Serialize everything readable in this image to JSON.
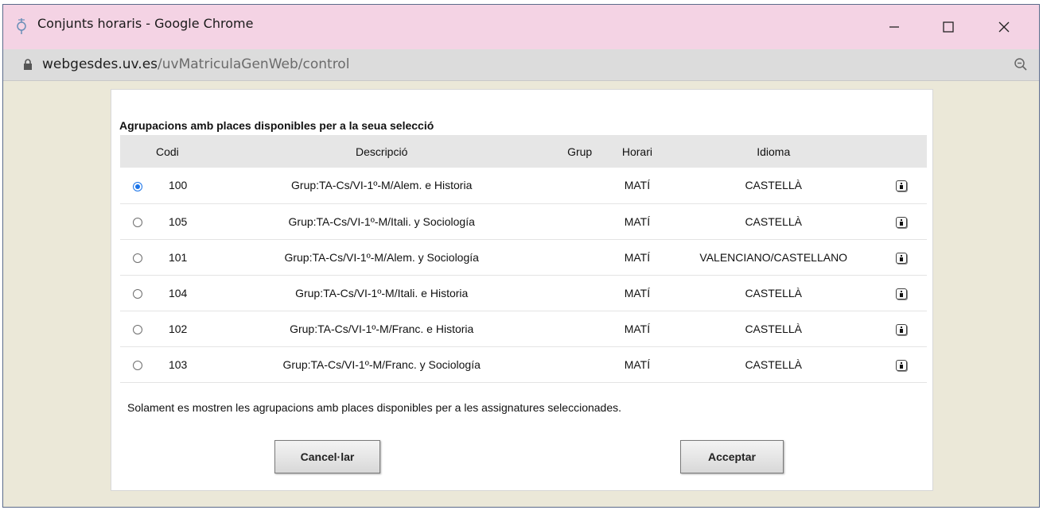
{
  "window": {
    "title": "Conjunts horaris - Google Chrome",
    "url_host": "webgesdes.uv.es",
    "url_path": "/uvMatriculaGenWeb/control"
  },
  "panel": {
    "heading": "Agrupacions amb places disponibles per a la seua selecció",
    "columns": {
      "codi": "Codi",
      "descripcio": "Descripció",
      "grup": "Grup",
      "horari": "Horari",
      "idioma": "Idioma"
    },
    "rows": [
      {
        "codi": "100",
        "descripcio": "Grup:TA-Cs/VI-1º-M/Alem. e Historia",
        "grup": "",
        "horari": "MATÍ",
        "idioma": "CASTELLÀ",
        "selected": true
      },
      {
        "codi": "105",
        "descripcio": "Grup:TA-Cs/VI-1º-M/Itali. y Sociología",
        "grup": "",
        "horari": "MATÍ",
        "idioma": "CASTELLÀ",
        "selected": false
      },
      {
        "codi": "101",
        "descripcio": "Grup:TA-Cs/VI-1º-M/Alem. y Sociología",
        "grup": "",
        "horari": "MATÍ",
        "idioma": "VALENCIANO/CASTELLANO",
        "selected": false
      },
      {
        "codi": "104",
        "descripcio": "Grup:TA-Cs/VI-1º-M/Itali. e Historia",
        "grup": "",
        "horari": "MATÍ",
        "idioma": "CASTELLÀ",
        "selected": false
      },
      {
        "codi": "102",
        "descripcio": "Grup:TA-Cs/VI-1º-M/Franc. e Historia",
        "grup": "",
        "horari": "MATÍ",
        "idioma": "CASTELLÀ",
        "selected": false
      },
      {
        "codi": "103",
        "descripcio": "Grup:TA-Cs/VI-1º-M/Franc. y Sociología",
        "grup": "",
        "horari": "MATÍ",
        "idioma": "CASTELLÀ",
        "selected": false
      }
    ],
    "footnote": "Solament es mostren les agrupacions amb places disponibles per a les assignatures seleccionades.",
    "cancel_label": "Cancel·lar",
    "accept_label": "Acceptar"
  },
  "icons": {
    "app": "chrome-app-icon",
    "lock": "lock-icon",
    "zoom": "zoom-out-icon",
    "info": "info-icon"
  },
  "colors": {
    "titlebar": "#f4d3e4",
    "page_background": "#ebe8d8",
    "radio_accent": "#1a73e8"
  }
}
